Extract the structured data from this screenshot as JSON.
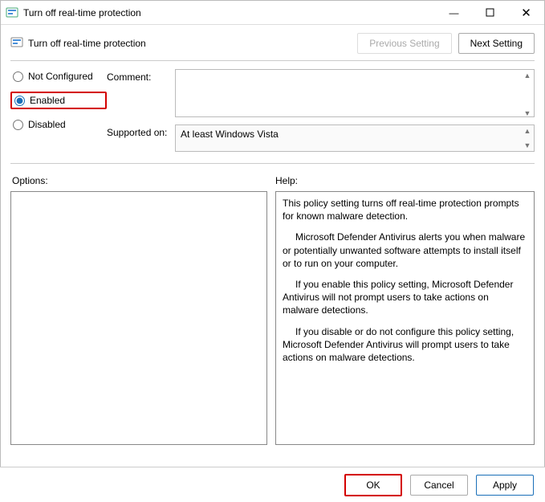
{
  "window": {
    "title": "Turn off real-time protection"
  },
  "header": {
    "title": "Turn off real-time protection",
    "prev_btn": "Previous Setting",
    "next_btn": "Next Setting"
  },
  "radios": {
    "not_configured": "Not Configured",
    "enabled": "Enabled",
    "disabled": "Disabled",
    "selected": "enabled"
  },
  "fields": {
    "comment_label": "Comment:",
    "comment_value": "",
    "supported_label": "Supported on:",
    "supported_value": "At least Windows Vista"
  },
  "panes": {
    "options_label": "Options:",
    "help_label": "Help:",
    "help_paragraphs": [
      "This policy setting turns off real-time protection prompts for known malware detection.",
      "Microsoft Defender Antivirus alerts you when malware or potentially unwanted software attempts to install itself or to run on your computer.",
      "If you enable this policy setting, Microsoft Defender Antivirus will not prompt users to take actions on malware detections.",
      "If you disable or do not configure this policy setting, Microsoft Defender Antivirus will prompt users to take actions on malware detections."
    ]
  },
  "footer": {
    "ok": "OK",
    "cancel": "Cancel",
    "apply": "Apply"
  }
}
